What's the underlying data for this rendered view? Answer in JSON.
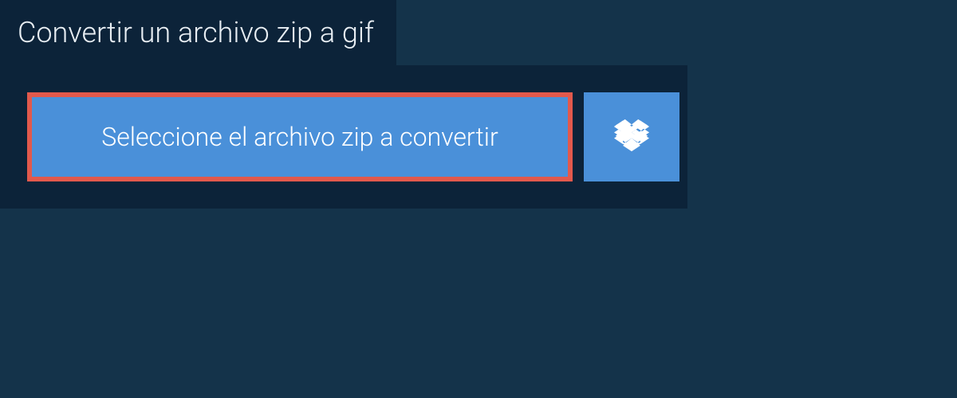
{
  "tab": {
    "title": "Convertir un archivo zip a gif"
  },
  "actions": {
    "select_file_label": "Seleccione el archivo zip a convertir",
    "dropbox_icon": "dropbox"
  },
  "colors": {
    "page_bg": "#14334a",
    "panel_bg": "#0c2339",
    "button_bg": "#4a90d9",
    "highlight_border": "#e2594c",
    "text_light": "#ffffff"
  }
}
